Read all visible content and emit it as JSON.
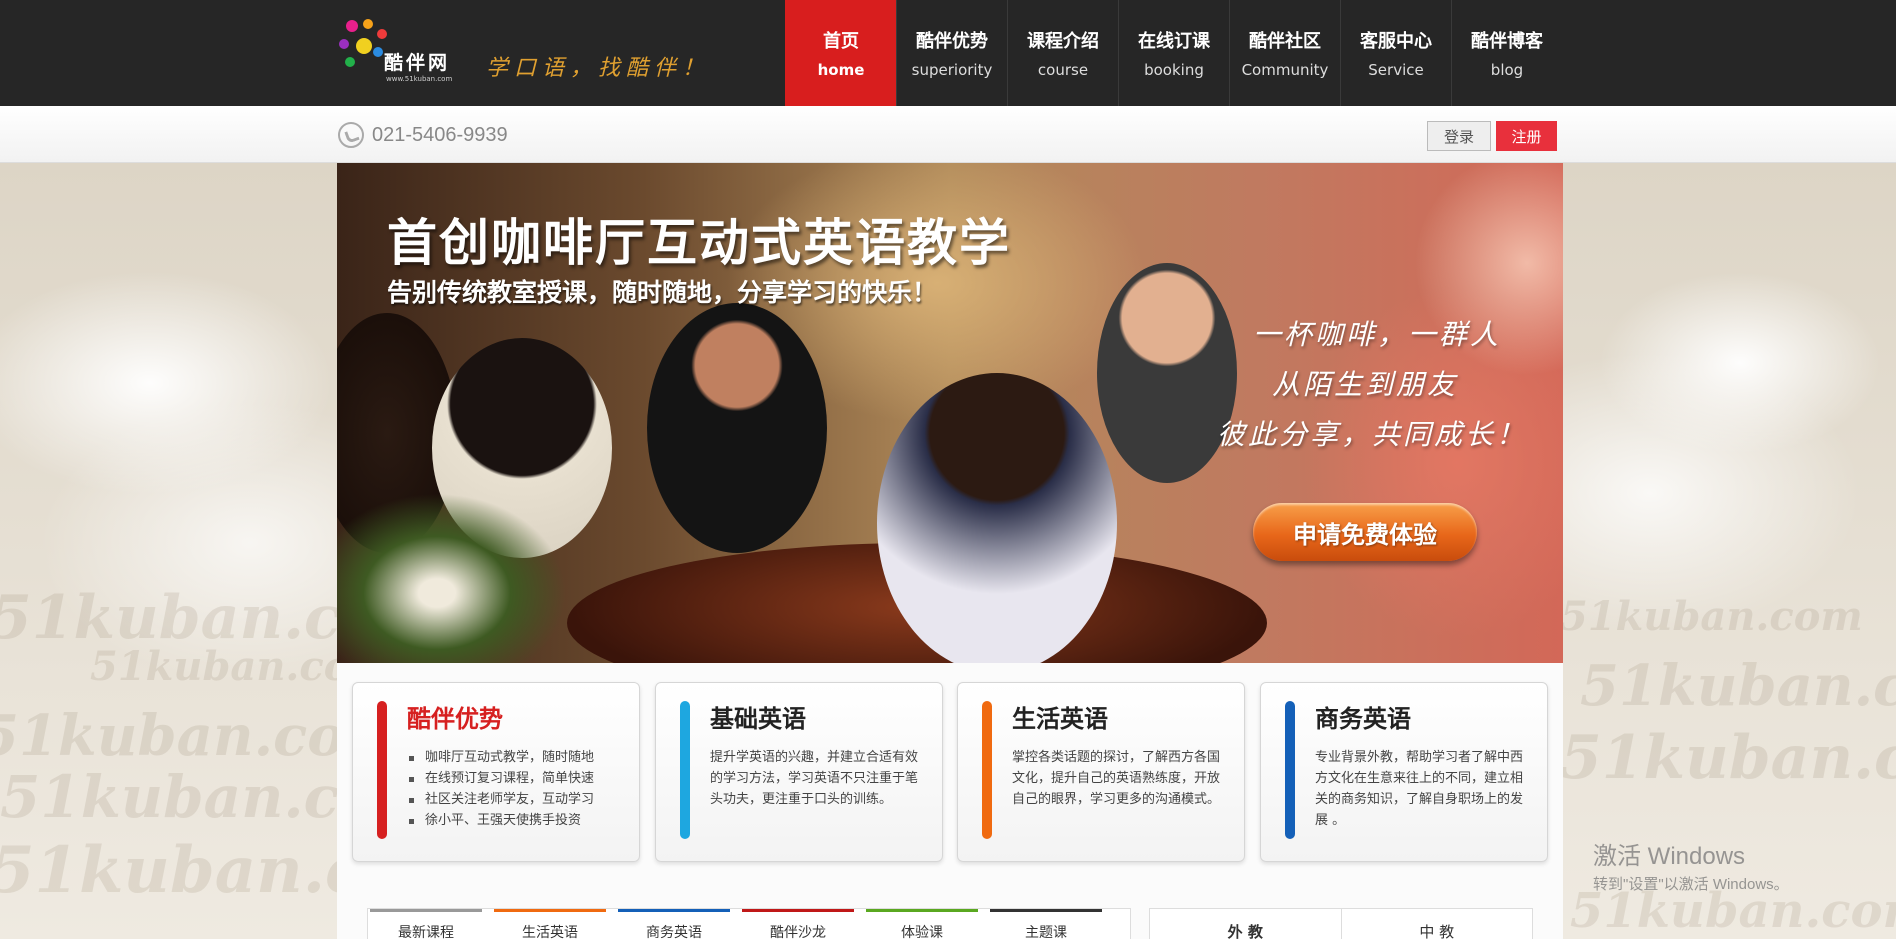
{
  "header": {
    "logo_text": "酷伴网",
    "logo_url": "www.51kuban.com",
    "slogan": "学口语，找酷伴！",
    "nav": [
      {
        "cn": "首页",
        "en": "home",
        "active": true
      },
      {
        "cn": "酷伴优势",
        "en": "superiority",
        "active": false
      },
      {
        "cn": "课程介绍",
        "en": "course",
        "active": false
      },
      {
        "cn": "在线订课",
        "en": "booking",
        "active": false
      },
      {
        "cn": "酷伴社区",
        "en": "Community",
        "active": false
      },
      {
        "cn": "客服中心",
        "en": "Service",
        "active": false
      },
      {
        "cn": "酷伴博客",
        "en": "blog",
        "active": false
      }
    ]
  },
  "subbar": {
    "phone": "021-5406-9939",
    "login_label": "登录",
    "register_label": "注册"
  },
  "banner": {
    "title": "首创咖啡厅互动式英语教学",
    "subtitle": "告别传统教室授课，随时随地，分享学习的快乐！",
    "hand_lines": [
      "一杯咖啡，一群人",
      "从陌生到朋友",
      "彼此分享，共同成长！"
    ],
    "cta_label": "申请免费体验"
  },
  "features": [
    {
      "title": "酷伴优势",
      "color": "#d62020",
      "title_color": "#d62020",
      "items": [
        "咖啡厅互动式教学，随时随地",
        "在线预订复习课程，简单快速",
        "社区关注老师学友，互动学习",
        "徐小平、王强天使携手投资"
      ]
    },
    {
      "title": "基础英语",
      "color": "#1ea7e0",
      "title_color": "#222222",
      "text": "提升学英语的兴趣，并建立合适有效的学习方法，学习英语不只注重于笔头功夫，更注重于口头的训练。"
    },
    {
      "title": "生活英语",
      "color": "#f06a10",
      "title_color": "#222222",
      "text": "掌控各类话题的探讨，了解西方各国文化，提升自己的英语熟练度，开放自己的眼界，学习更多的沟通模式。"
    },
    {
      "title": "商务英语",
      "color": "#1460b8",
      "title_color": "#222222",
      "text": "专业背景外教，帮助学习者了解中西方文化在生意来往上的不同，建立相关的商务知识，了解自身职场上的发展 。"
    }
  ],
  "course_tabs": [
    {
      "label": "最新课程",
      "color": "#999999"
    },
    {
      "label": "生活英语",
      "color": "#f06a10"
    },
    {
      "label": "商务英语",
      "color": "#1460b8"
    },
    {
      "label": "酷伴沙龙",
      "color": "#c01818"
    },
    {
      "label": "体验课",
      "color": "#5aa820"
    },
    {
      "label": "主题课",
      "color": "#333333"
    }
  ],
  "teacher_tabs": [
    {
      "label": "外 教",
      "active": true
    },
    {
      "label": "中 教",
      "active": false
    }
  ],
  "windows_activation": {
    "line1": "激活 Windows",
    "line2": "转到\"设置\"以激活 Windows。"
  },
  "watermark_text": "51kuban.com"
}
